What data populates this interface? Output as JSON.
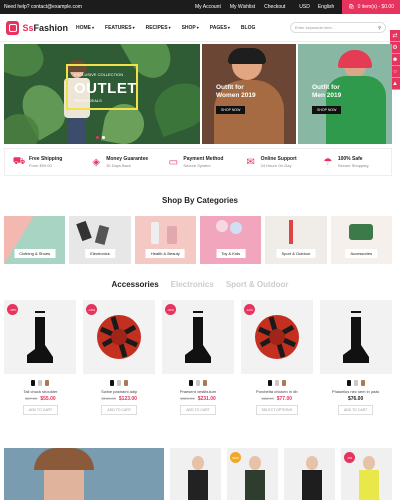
{
  "topbar": {
    "help": "Need help? contact@example.com",
    "links": [
      "My Account",
      "My Wishlist",
      "Checkout"
    ],
    "currency": "USD",
    "language": "English",
    "cart": "0 item(s) - $0.00"
  },
  "header": {
    "logo_prefix": "Ss",
    "logo_main": "Fashion",
    "nav": [
      "HOME",
      "FEATURES",
      "RECIPES",
      "SHOP",
      "PAGES",
      "BLOG"
    ],
    "search_placeholder": "Enter keywords here..."
  },
  "banners": {
    "main": {
      "small": "EXCLUSIVE COLLECTION",
      "title": "OUTLET",
      "sub": "FRESH DEALS"
    },
    "women": {
      "title_line1": "Outfit for",
      "title_line2": "Women 2019",
      "button": "SHOP NOW"
    },
    "men": {
      "title_line1": "Outfit for",
      "title_line2": "Men 2019",
      "button": "SHOP NOW"
    }
  },
  "features": [
    {
      "title": "Free Shipping",
      "sub": "From $99.00",
      "icon": "truck-icon"
    },
    {
      "title": "Money Guarantee",
      "sub": "30 Days Back",
      "icon": "money-bag-icon"
    },
    {
      "title": "Payment Method",
      "sub": "Secure System",
      "icon": "card-icon"
    },
    {
      "title": "Online Support",
      "sub": "24 Hours On Day",
      "icon": "chat-icon"
    },
    {
      "title": "100% Safe",
      "sub": "Secure Shopping",
      "icon": "umbrella-icon"
    }
  ],
  "categories": {
    "title": "Shop By Categories",
    "items": [
      "Clothing & Shoes",
      "Electronics",
      "Health & Beauty",
      "Toy & Kids",
      "Sport & Outdoor",
      "Accessories"
    ]
  },
  "tabs": [
    "Accessories",
    "Electronics",
    "Sport & Outdoor"
  ],
  "products": [
    {
      "badge": "-18%",
      "name": "Tall chuck shoulder",
      "old": "$67.00",
      "new": "$55.00",
      "cart": "ADD TO CART",
      "type": "boot"
    },
    {
      "badge": "-16%",
      "name": "Swine pastrami adip",
      "old": "$150.00",
      "new": "$123.00",
      "cart": "ADD TO CART",
      "type": "scarf"
    },
    {
      "badge": "-30%",
      "name": "Praesent vestibulum",
      "old": "$320.00",
      "new": "$231.00",
      "cart": "ADD TO CART",
      "type": "boot"
    },
    {
      "badge": "-12%",
      "name": "Porchetta chicken in db",
      "old": "$88.00",
      "new": "$77.00",
      "cart": "SELECT OPTIONS",
      "type": "scarf"
    },
    {
      "badge": "",
      "name": "Phasellus nec sem in justo",
      "old": "",
      "new": "$76.00",
      "cart": "ADD TO CART",
      "type": "boot"
    }
  ],
  "bottom_badges": [
    "NEW",
    "-6%"
  ],
  "colors": {
    "accent": "#e8335e",
    "dark": "#1c1c1c"
  }
}
